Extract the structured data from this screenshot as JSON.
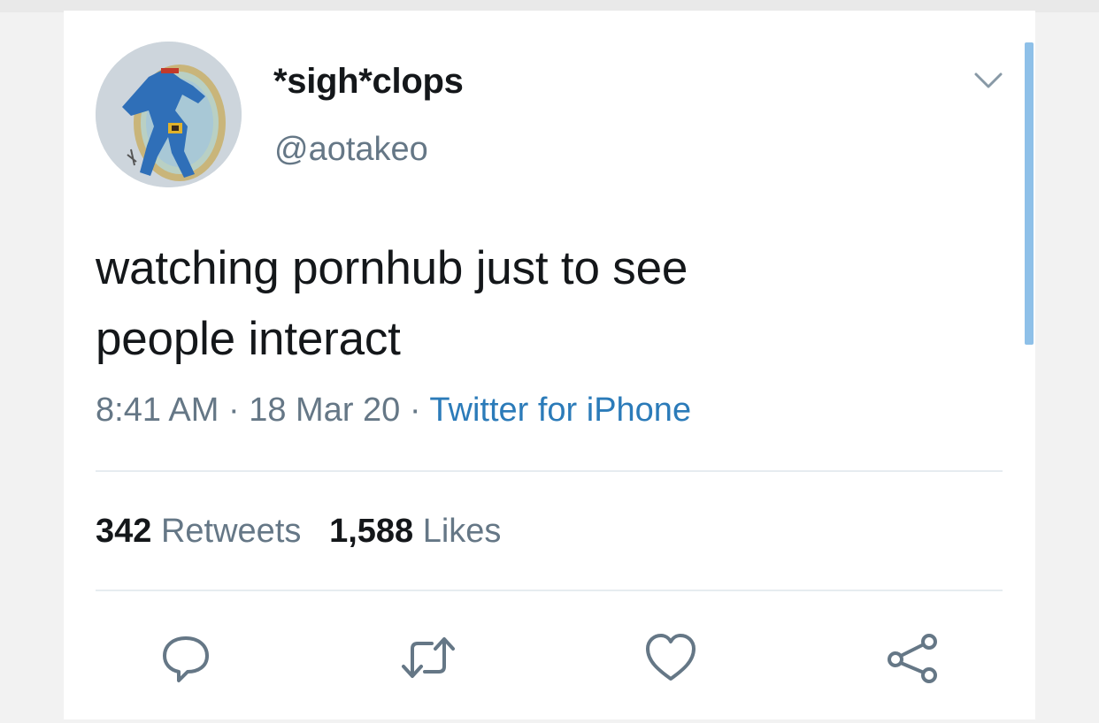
{
  "user": {
    "display_name": "*sigh*clops",
    "handle": "@aotakeo"
  },
  "tweet": {
    "text_line1": "watching pornhub just to see",
    "text_line2": "people interact",
    "time": "8:41 AM",
    "date": "18 Mar 20",
    "separator": " · ",
    "source": "Twitter for iPhone"
  },
  "stats": {
    "retweets_count": "342",
    "retweets_label": "Retweets",
    "likes_count": "1,588",
    "likes_label": "Likes"
  },
  "actions": {
    "reply_icon": "reply-icon",
    "retweet_icon": "retweet-icon",
    "like_icon": "heart-icon",
    "share_icon": "share-icon"
  },
  "colors": {
    "text": "#14171a",
    "secondary": "#657786",
    "link": "#2b7bb9",
    "scrollbar": "#8ec0e8"
  }
}
